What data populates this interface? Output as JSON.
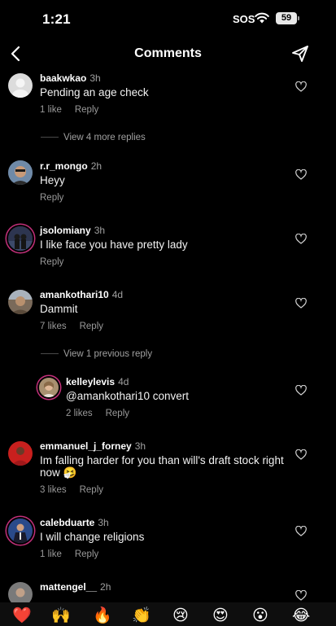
{
  "status": {
    "time": "1:21",
    "sos": "SOS",
    "battery": "59"
  },
  "header": {
    "title": "Comments",
    "back_icon": "chevron-left-icon",
    "send_icon": "paper-plane-icon"
  },
  "comments": [
    {
      "user": "baakwkao",
      "time": "3h",
      "text": "Pending an age check",
      "likes": "1 like",
      "reply": "Reply"
    },
    {
      "user": "r.r_mongo",
      "time": "2h",
      "text": "Heyy",
      "reply": "Reply"
    },
    {
      "user": "jsolomiany",
      "time": "3h",
      "text": "I like face you have pretty lady",
      "reply": "Reply"
    },
    {
      "user": "amankothari10",
      "time": "4d",
      "text": "Dammit",
      "likes": "7 likes",
      "reply": "Reply"
    },
    {
      "user": "kelleylevis",
      "time": "4d",
      "text": "@amankothari10 convert",
      "likes": "2 likes",
      "reply": "Reply"
    },
    {
      "user": "emmanuel_j_forney",
      "time": "3h",
      "text": "Im falling harder for you than will's draft stock right now 🤧",
      "likes": "3 likes",
      "reply": "Reply"
    },
    {
      "user": "calebduarte",
      "time": "3h",
      "text": "I will change religions",
      "likes": "1 like",
      "reply": "Reply"
    },
    {
      "user": "mattengel__",
      "time": "2h"
    }
  ],
  "view_more_replies": "View 4 more replies",
  "view_previous_reply": "View 1 previous reply",
  "emoji_bar": [
    "❤️",
    "🙌",
    "🔥",
    "👏",
    "😢",
    "😍",
    "😮",
    "😂"
  ],
  "colors": {
    "background": "#000000",
    "secondary_text": "#a0a0a0",
    "story_ring": "#c3307a"
  }
}
